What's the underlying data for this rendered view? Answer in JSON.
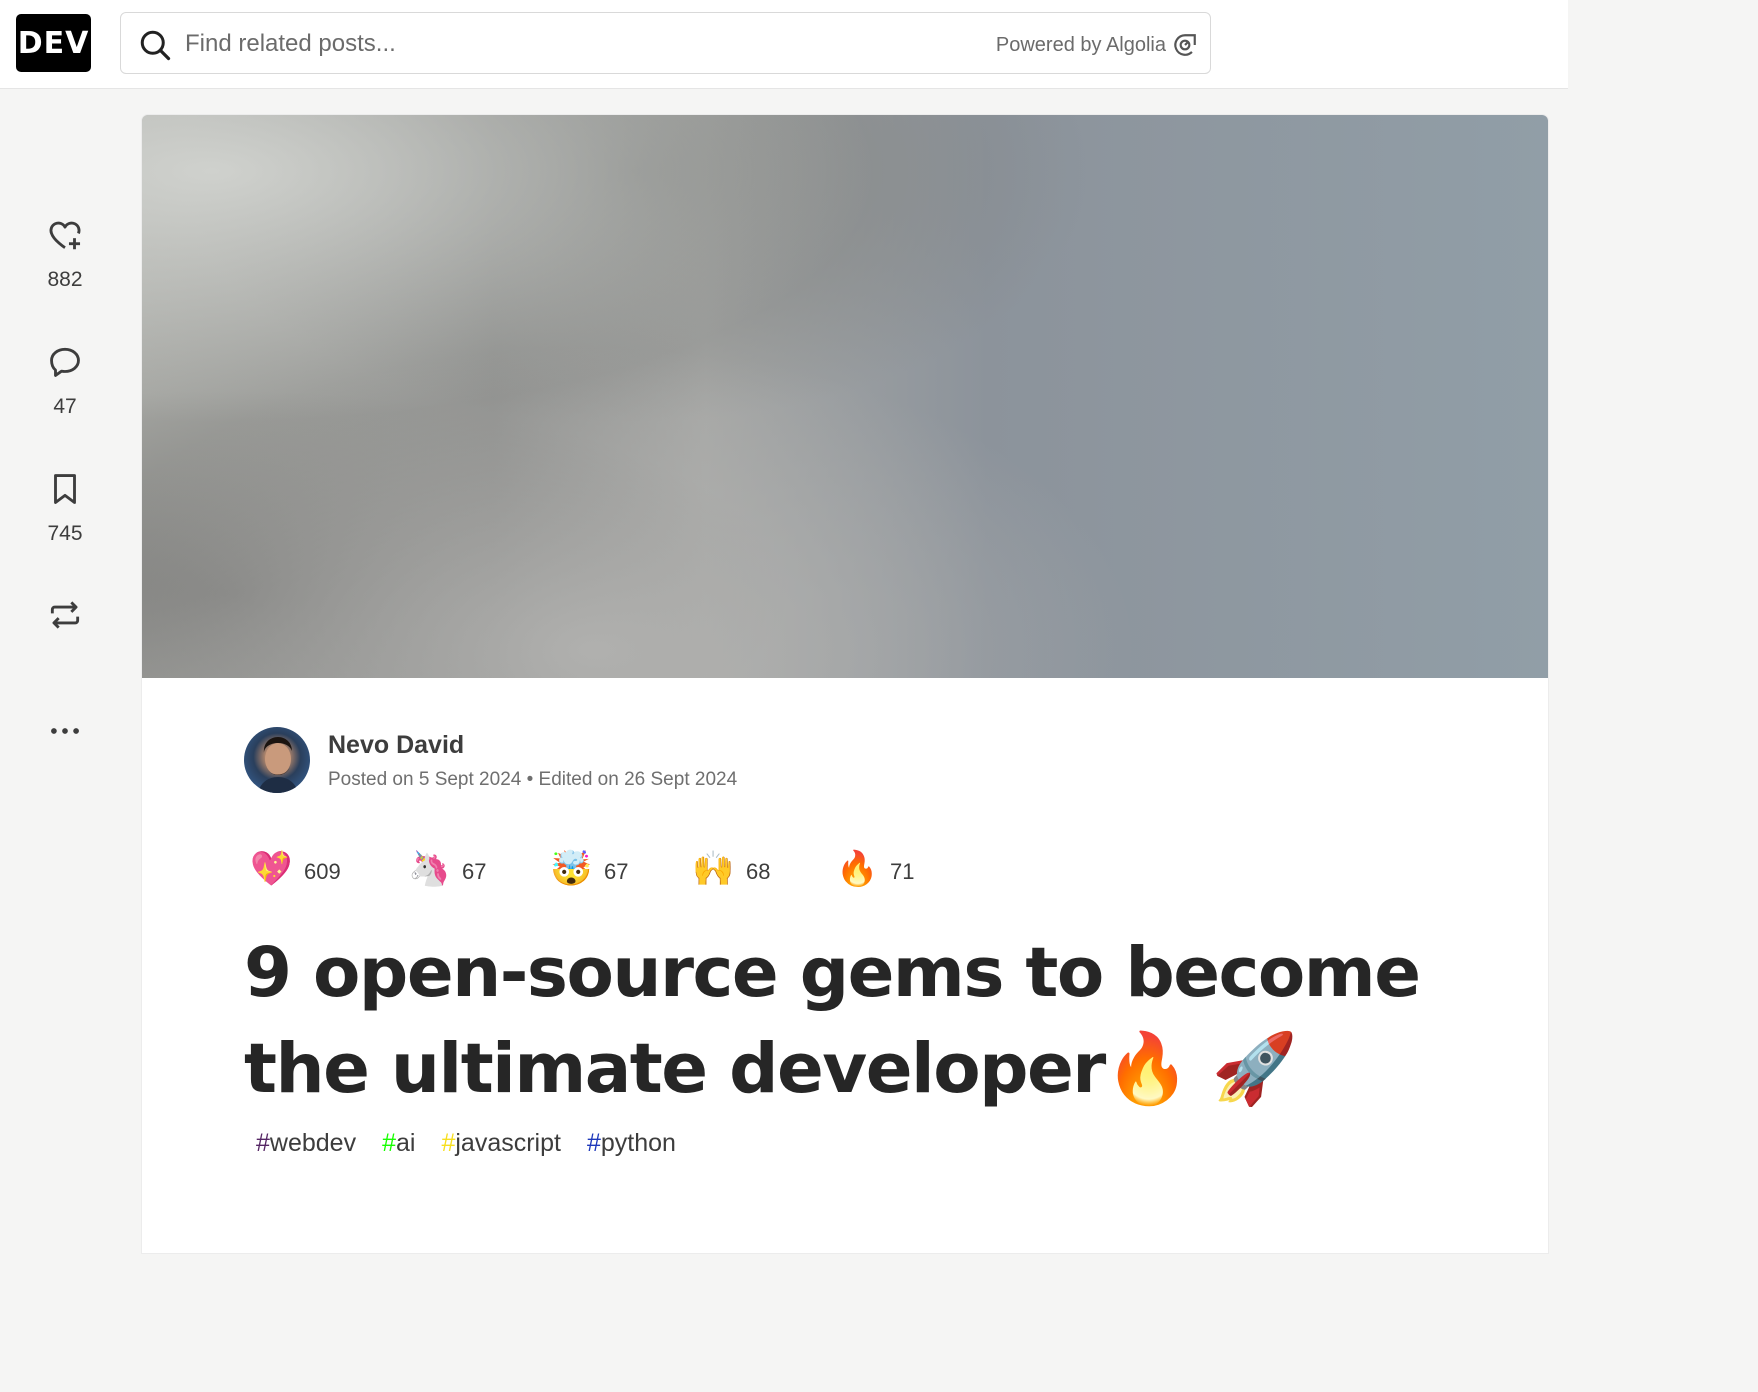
{
  "header": {
    "logo": "DEV",
    "search_placeholder": "Find related posts...",
    "powered_by": "Powered by Algolia"
  },
  "sidebar": {
    "reactions_count": "882",
    "comments_count": "47",
    "bookmarks_count": "745"
  },
  "article": {
    "author_name": "Nevo David",
    "posted": "Posted on 5 Sept 2024 • Edited on 26 Sept 2024",
    "reactions": [
      {
        "icon": "sparkle-heart",
        "emoji": "💖",
        "count": "609"
      },
      {
        "icon": "unicorn",
        "emoji": "🦄",
        "count": "67"
      },
      {
        "icon": "exploding-head",
        "emoji": "🤯",
        "count": "67"
      },
      {
        "icon": "raised-hands",
        "emoji": "🙌",
        "count": "68"
      },
      {
        "icon": "fire",
        "emoji": "🔥",
        "count": "71"
      }
    ],
    "title": "9 open-source gems to become the ultimate developer🔥 🚀",
    "tags": [
      {
        "hash": "#",
        "name": "webdev",
        "color": "#562765"
      },
      {
        "hash": "#",
        "name": "ai",
        "color": "#17ff00"
      },
      {
        "hash": "#",
        "name": "javascript",
        "color": "#f7df1e"
      },
      {
        "hash": "#",
        "name": "python",
        "color": "#1e38bb"
      }
    ]
  }
}
